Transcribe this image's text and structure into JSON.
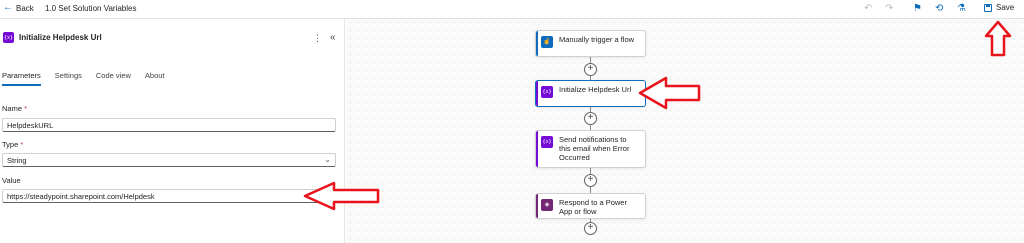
{
  "header": {
    "back_label": "Back",
    "title": "1.0 Set Solution Variables",
    "save_label": "Save"
  },
  "panel": {
    "title": "Initialize Helpdesk Url",
    "icon_text": "{x}",
    "tabs": [
      "Parameters",
      "Settings",
      "Code view",
      "About"
    ],
    "name_label": "Name",
    "name_value": "HelpdeskURL",
    "type_label": "Type",
    "type_value": "String",
    "value_label": "Value",
    "value_value": "https://steadypoint.sharepoint.com/Helpdesk"
  },
  "flow": {
    "steps": [
      {
        "label": "Manually trigger a flow",
        "icon": "trigger-icon"
      },
      {
        "label": "Initialize Helpdesk Url",
        "icon": "variable-icon"
      },
      {
        "label": "Send notifications to this email when Error Occurred",
        "icon": "variable-icon"
      },
      {
        "label": "Respond to a Power App or flow",
        "icon": "powerapps-icon"
      }
    ]
  },
  "colors": {
    "accent": "#0f6cbd",
    "variable": "#770bd6",
    "annotation": "#e8141c"
  }
}
